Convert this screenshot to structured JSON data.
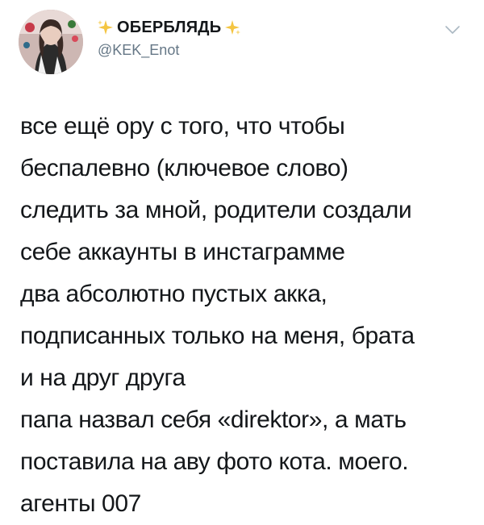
{
  "tweet": {
    "display_name": "ОБЕРБЛЯДЬ",
    "handle": "@KEK_Enot",
    "avatar_icon": "avatar-photo",
    "sparkle_icon": "sparkles-emoji",
    "menu_icon": "chevron-down-icon",
    "colors": {
      "text": "#14171a",
      "handle": "#657786",
      "chevron": "#aab8c2",
      "sparkle": "#f4c542"
    },
    "lines": [
      "все ещё ору с того, что чтобы",
      "беспалевно (ключевое слово)",
      "следить за мной, родители создали",
      "себе аккаунты в инстаграмме",
      "два абсолютно пустых акка,",
      "подписанных только на меня, брата",
      "и на друг друга",
      "папа назвал себя «direktor», а мать",
      "поставила на аву фото кота. моего.",
      "агенты 007"
    ]
  }
}
